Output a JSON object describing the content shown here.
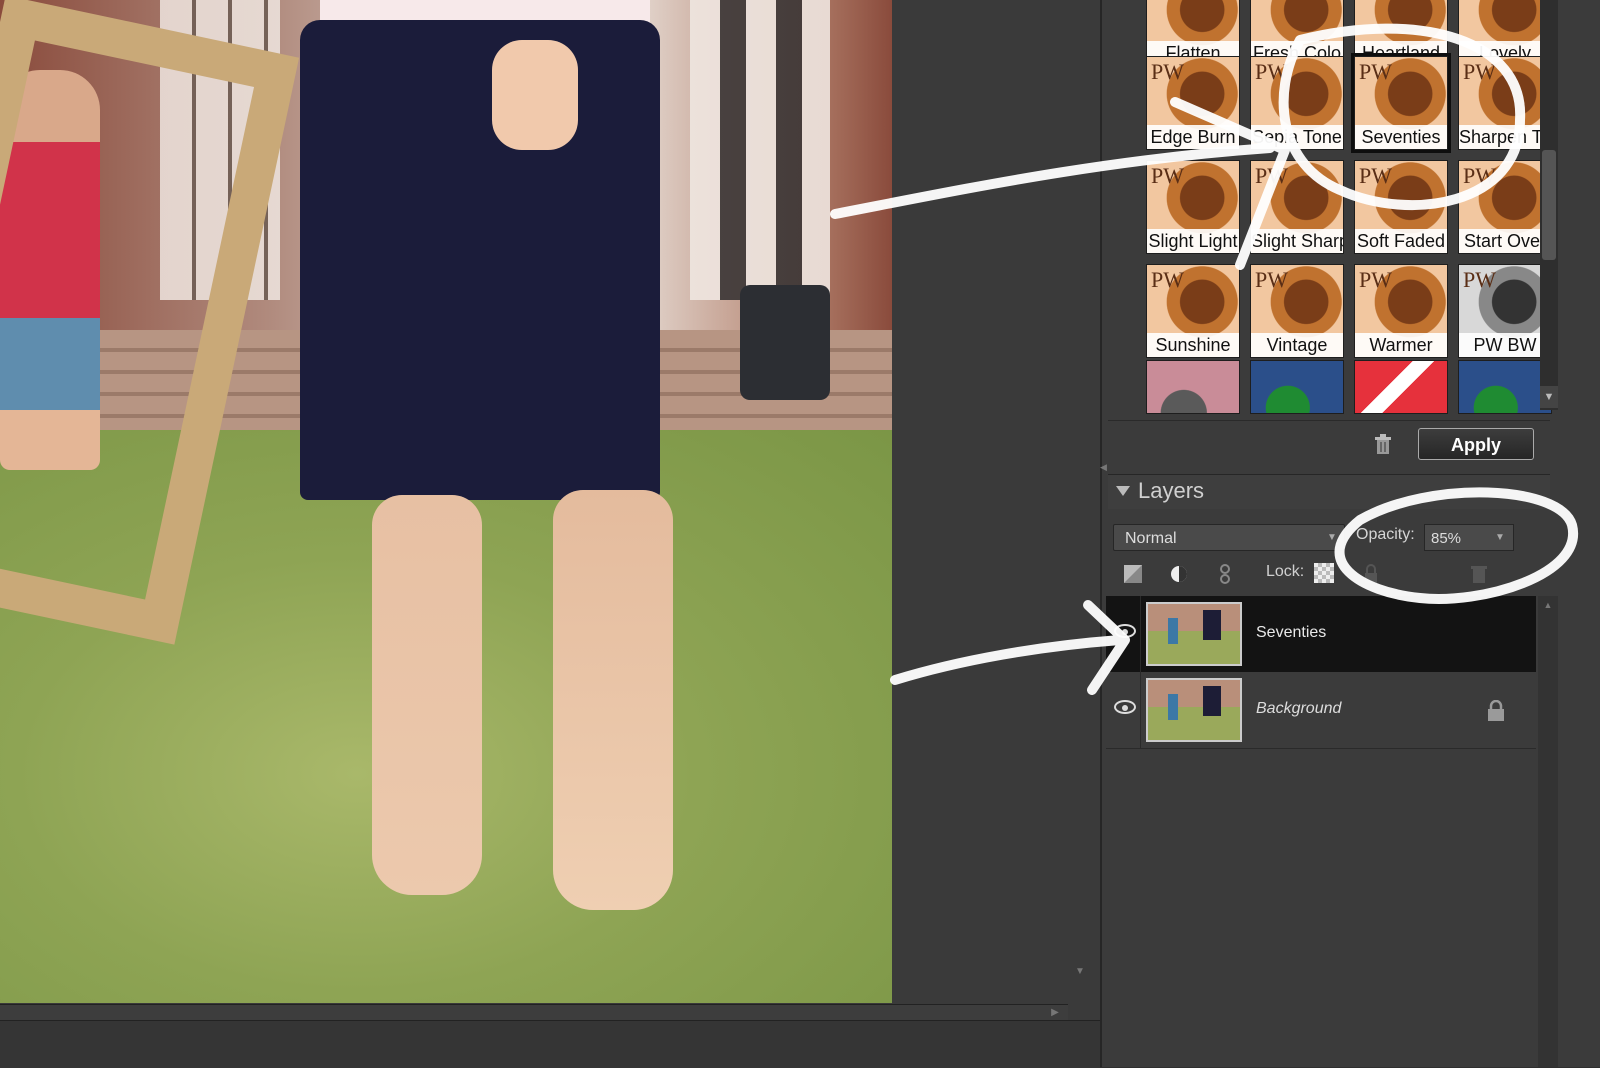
{
  "effects": {
    "tiles": [
      {
        "label": "Flatten"
      },
      {
        "label": "Fresh Colo"
      },
      {
        "label": "Heartland"
      },
      {
        "label": "Lovely"
      },
      {
        "label": "Edge Burn"
      },
      {
        "label": "Sepia Tone"
      },
      {
        "label": "Seventies",
        "selected": true
      },
      {
        "label": "Sharpen This"
      },
      {
        "label": "Slight Light"
      },
      {
        "label": "Slight Sharp"
      },
      {
        "label": "Soft Faded"
      },
      {
        "label": "Start Over"
      },
      {
        "label": "Sunshine"
      },
      {
        "label": "Vintage"
      },
      {
        "label": "Warmer"
      },
      {
        "label": "PW BW"
      }
    ],
    "pw_mark": "PW",
    "apply_label": "Apply"
  },
  "layers": {
    "title": "Layers",
    "blend_mode": "Normal",
    "opacity_label": "Opacity:",
    "opacity_value": "85%",
    "lock_label": "Lock:",
    "rows": [
      {
        "name": "Seventies",
        "selected": true
      },
      {
        "name": "Background",
        "locked": true
      }
    ]
  },
  "icons": [
    "trash-icon",
    "eye-icon",
    "lock-icon",
    "adjustment-layer-icon",
    "new-layer-icon",
    "link-icon",
    "chevron-down-icon"
  ]
}
